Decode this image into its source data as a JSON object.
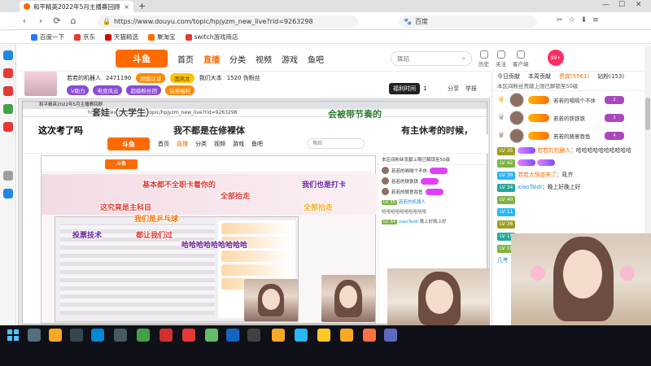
{
  "browser": {
    "tab_title": "和平精英2022年5月主播赛回顾",
    "tab_close": "×",
    "new_tab": "+",
    "url": "https://www.douyu.com/topic/hpjyzm_new_live?rid=9263298",
    "search_engine": "百度",
    "nav": [
      "‹",
      "›",
      "⟳",
      "⌂"
    ],
    "window_controls": [
      "—",
      "☐",
      "✕"
    ],
    "bookmarks": [
      {
        "label": "百度一下",
        "color": "#2979ff"
      },
      {
        "label": "京东",
        "color": "#e53935"
      },
      {
        "label": "天猫精选",
        "color": "#d50000"
      },
      {
        "label": "聚淘宝",
        "color": "#ff6d00"
      },
      {
        "label": "switch游戏商店",
        "color": "#e53935"
      }
    ]
  },
  "douyu": {
    "logo": "斗鱼",
    "nav": [
      "首页",
      "直播",
      "分类",
      "视频",
      "游戏",
      "鱼吧"
    ],
    "active_nav": "直播",
    "search_placeholder": "舞蹈",
    "utils": [
      "历史",
      "关注",
      "客户端"
    ],
    "avatar_label": "99+"
  },
  "room": {
    "follow": "若若的机器人",
    "followers": "2471190",
    "verified": "颜值认证",
    "tag": "国风女",
    "channel": "我们大本",
    "count": "1520 伪粉丝",
    "pill1": "V助力",
    "pill2": "电竞风云",
    "pill3": "超级粉丝团",
    "pill4": "钻粉福利",
    "timer_label": "福利时间",
    "timer_value": "1",
    "share": "分享",
    "report": "举报"
  },
  "danmaku": [
    {
      "text": "会被带节奏的",
      "color": "#2e7d32",
      "size": "big"
    },
    {
      "text": "套娃（大学生）",
      "color": "#424242",
      "size": "big"
    },
    {
      "text": "这次考了吗",
      "color": "#000000",
      "size": "big"
    },
    {
      "text": "我不都是在修裸体",
      "color": "#212121",
      "size": "big"
    },
    {
      "text": "有主休考的时候，",
      "color": "#212121",
      "size": "big"
    },
    {
      "text": "基本都不全职卡着你的",
      "color": "#e53935",
      "size": "mid"
    },
    {
      "text": "全部抬走",
      "color": "#e53935",
      "size": "mid"
    },
    {
      "text": "我们也是打卡",
      "color": "#6a1b9a",
      "size": "mid"
    },
    {
      "text": "这究竟是主科目",
      "color": "#e53935",
      "size": "mid"
    },
    {
      "text": "我们是乒乓球",
      "color": "#ff6f00",
      "size": "mid"
    },
    {
      "text": "全部抬走",
      "color": "#f9a825",
      "size": "mid"
    },
    {
      "text": "哈哈哈哈哈哈哈哈哈",
      "color": "#6a1b9a",
      "size": "mid"
    },
    {
      "text": "投票技术",
      "color": "#6a1b9a",
      "size": "mid"
    },
    {
      "text": "都让我们过",
      "color": "#e53935",
      "size": "mid"
    }
  ],
  "sidebar": {
    "tabs": [
      "今日贡献",
      "本周贡献",
      "贵宾(5561)",
      "钻粉(153)"
    ],
    "active_tab": "贵宾(5561)",
    "notice": "本区间粉丝贡献上限已解锁至50级",
    "rank": [
      {
        "crown": "♛",
        "crown_color": "#ffb300",
        "name": "若若的嗝嗝个不休",
        "badge": "2"
      },
      {
        "crown": "♛",
        "crown_color": "#90a4ae",
        "name": "若若的铁铁铁",
        "badge": "3"
      },
      {
        "crown": "♛",
        "crown_color": "#a1887f",
        "name": "若若的随意吞鱼",
        "badge": "4"
      }
    ],
    "chat": [
      {
        "lv": "LV 35",
        "lv_class": "lv-olive",
        "name": "若若的机器人",
        "text": "哈哈哈哈哈哈哈哈哈哈",
        "name_class": "chname"
      },
      {
        "lv": "LV 42",
        "lv_class": "lv-green",
        "name": "",
        "text": "",
        "name_class": "chname"
      },
      {
        "lv": "LV 36",
        "lv_class": "lv-blue",
        "name": "若若大怪兽来了",
        "text": "吼齐",
        "name_class": "chname"
      },
      {
        "lv": "LV 34",
        "lv_class": "lv-teal",
        "name": "xiaoTaidi",
        "text": "晚上好晚上好",
        "name_class": "chname2"
      },
      {
        "lv": "LV 40",
        "lv_class": "lv-green",
        "name": "",
        "text": "",
        "name_class": "chname"
      },
      {
        "lv": "LV 11",
        "lv_class": "lv-blue",
        "name": "",
        "text": "",
        "name_class": "chname"
      },
      {
        "lv": "LV 36",
        "lv_class": "lv-olive",
        "name": "",
        "text": "",
        "name_class": "chname"
      },
      {
        "lv": "LV 15",
        "lv_class": "lv-teal",
        "name": "",
        "text": "",
        "name_class": "chname"
      },
      {
        "lv": "LV 18",
        "lv_class": "lv-green",
        "name": "",
        "text": "",
        "name_class": "chname"
      },
      {
        "lv": "",
        "lv_class": "",
        "name": "几考",
        "text": "",
        "name_class": "chname2"
      }
    ]
  },
  "taskbar": {
    "apps": [
      {
        "name": "search",
        "color": "#546e7a"
      },
      {
        "name": "file-explorer",
        "color": "#f9a825"
      },
      {
        "name": "unreal",
        "color": "#37474f"
      },
      {
        "name": "edge",
        "color": "#0288d1"
      },
      {
        "name": "chat",
        "color": "#455a64"
      },
      {
        "name": "wechat",
        "color": "#43a047"
      },
      {
        "name": "netease",
        "color": "#d32f2f"
      },
      {
        "name": "chrome",
        "color": "#e53935"
      },
      {
        "name": "360",
        "color": "#66bb6a"
      },
      {
        "name": "steam",
        "color": "#1565c0"
      },
      {
        "name": "g-app",
        "color": "#424242"
      },
      {
        "name": "game",
        "color": "#f9a825"
      },
      {
        "name": "notes",
        "color": "#29b6f6"
      },
      {
        "name": "folder",
        "color": "#ffca28"
      },
      {
        "name": "douyu",
        "color": "#f9a825"
      },
      {
        "name": "obs",
        "color": "#ff7043"
      },
      {
        "name": "app",
        "color": "#5c6bc0"
      }
    ]
  }
}
